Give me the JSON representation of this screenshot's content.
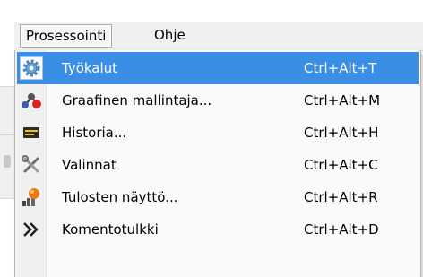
{
  "menubar": {
    "items": [
      {
        "label": "Prosessointi",
        "open": true
      },
      {
        "label": "Ohje",
        "open": false
      }
    ]
  },
  "dropdown": {
    "items": [
      {
        "label": "Työkalut",
        "shortcut": "Ctrl+Alt+T",
        "icon": "gear-icon",
        "highlighted": true
      },
      {
        "label": "Graafinen mallintaja...",
        "shortcut": "Ctrl+Alt+M",
        "icon": "graphical-modeler-icon",
        "highlighted": false
      },
      {
        "label": "Historia...",
        "shortcut": "Ctrl+Alt+H",
        "icon": "history-icon",
        "highlighted": false
      },
      {
        "label": "Valinnat",
        "shortcut": "Ctrl+Alt+C",
        "icon": "tools-options-icon",
        "highlighted": false
      },
      {
        "label": "Tulosten näyttö...",
        "shortcut": "Ctrl+Alt+R",
        "icon": "results-viewer-icon",
        "highlighted": false
      },
      {
        "label": "Komentotulkki",
        "shortcut": "Ctrl+Alt+D",
        "icon": "console-chevron-icon",
        "highlighted": false
      }
    ]
  },
  "colors": {
    "highlight": "#3a8ee6",
    "menubar_bg": "#f0f0f0",
    "dropdown_bg": "#fafafa"
  }
}
